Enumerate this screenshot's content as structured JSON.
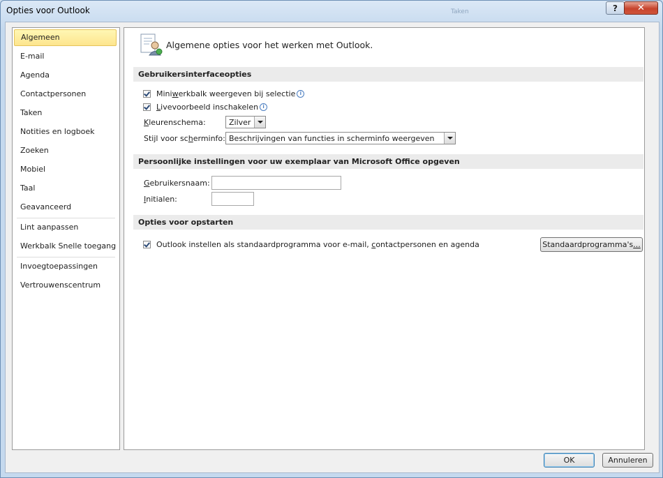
{
  "window": {
    "title": "Opties voor Outlook",
    "background_title": "Taken"
  },
  "titlebar": {
    "help_label": "?",
    "close_label": "✕"
  },
  "nav": {
    "items": [
      {
        "label": "Algemeen"
      },
      {
        "label": "E-mail"
      },
      {
        "label": "Agenda"
      },
      {
        "label": "Contactpersonen"
      },
      {
        "label": "Taken"
      },
      {
        "label": "Notities en logboek"
      },
      {
        "label": "Zoeken"
      },
      {
        "label": "Mobiel"
      },
      {
        "label": "Taal"
      },
      {
        "label": "Geavanceerd"
      },
      {
        "label": "Lint aanpassen"
      },
      {
        "label": "Werkbalk Snelle toegang"
      },
      {
        "label": "Invoegtoepassingen"
      },
      {
        "label": "Vertrouwenscentrum"
      }
    ],
    "selected": "Algemeen"
  },
  "header": {
    "text": "Algemene opties voor het werken met Outlook.",
    "icon": "general-options-icon"
  },
  "sections": {
    "ui": {
      "title": "Gebruikersinterfaceopties",
      "mini_toolbar": {
        "pre": "Mini",
        "u": "w",
        "post": "erkbalk weergeven bij selectie",
        "checked": true
      },
      "live_preview": {
        "pre": "",
        "u": "L",
        "post": "ivevoorbeeld inschakelen",
        "checked": true
      },
      "color_scheme": {
        "pre": "",
        "u": "K",
        "post": "leurenschema:",
        "value": "Zilver"
      },
      "screentip": {
        "pre": "Stijl voor sc",
        "u": "h",
        "post": "erminfo:",
        "value": "Beschrijvingen van functies in scherminfo weergeven"
      }
    },
    "personal": {
      "title": "Persoonlijke instellingen voor uw exemplaar van Microsoft Office opgeven",
      "username": {
        "pre": "",
        "u": "G",
        "post": "ebruikersnaam:",
        "value": ""
      },
      "initials": {
        "pre": "",
        "u": "I",
        "post": "nitialen:",
        "value": ""
      }
    },
    "startup": {
      "title": "Opties voor opstarten",
      "default_program": {
        "pre": "Outlook instellen als standaardprogramma voor e-mail, ",
        "u": "c",
        "post": "ontactpersonen en agenda",
        "checked": true
      },
      "default_programs_button": {
        "pre": "Standaardprogramma's",
        "u": "...",
        "post": ""
      }
    }
  },
  "footer": {
    "ok_label": "OK",
    "cancel_label": "Annuleren"
  },
  "colors": {
    "selected_item": "#fde58e",
    "section_bar": "#ebebeb",
    "close_button": "#c7442d"
  }
}
